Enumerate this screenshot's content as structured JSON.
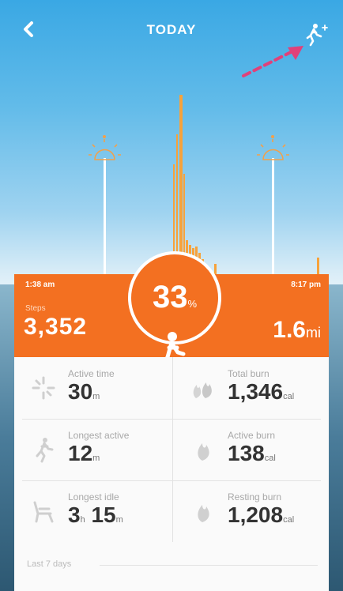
{
  "header": {
    "title": "TODAY",
    "back_icon": "chevron-left-icon",
    "action_icon": "running-man-plus-icon"
  },
  "colors": {
    "accent": "#f37021",
    "sky": "#3aa8e4",
    "annotation_arrow": "#e0417a"
  },
  "timeline": {
    "start_time": "1:38 am",
    "end_time": "8:17 pm",
    "markers": [
      "sunrise-icon",
      "sunset-icon"
    ]
  },
  "summary": {
    "steps_label": "Steps",
    "steps_value": "3,352",
    "goal_percent": "33",
    "goal_percent_unit": "%",
    "distance_value": "1.6",
    "distance_unit": "mi"
  },
  "stats": [
    {
      "icon": "burst-icon",
      "label": "Active time",
      "value": "30",
      "unit": "m"
    },
    {
      "icon": "flame-cluster-icon",
      "label": "Total burn",
      "value": "1,346",
      "unit": "cal"
    },
    {
      "icon": "running-man-icon",
      "label": "Longest active",
      "value": "12",
      "unit": "m"
    },
    {
      "icon": "flame-icon",
      "label": "Active burn",
      "value": "138",
      "unit": "cal"
    },
    {
      "icon": "chair-icon",
      "label": "Longest idle",
      "value": "3",
      "unit": "h",
      "value2": "15",
      "unit2": "m"
    },
    {
      "icon": "flame-icon",
      "label": "Resting burn",
      "value": "1,208",
      "unit": "cal"
    }
  ],
  "week": {
    "label": "Last 7 days"
  }
}
